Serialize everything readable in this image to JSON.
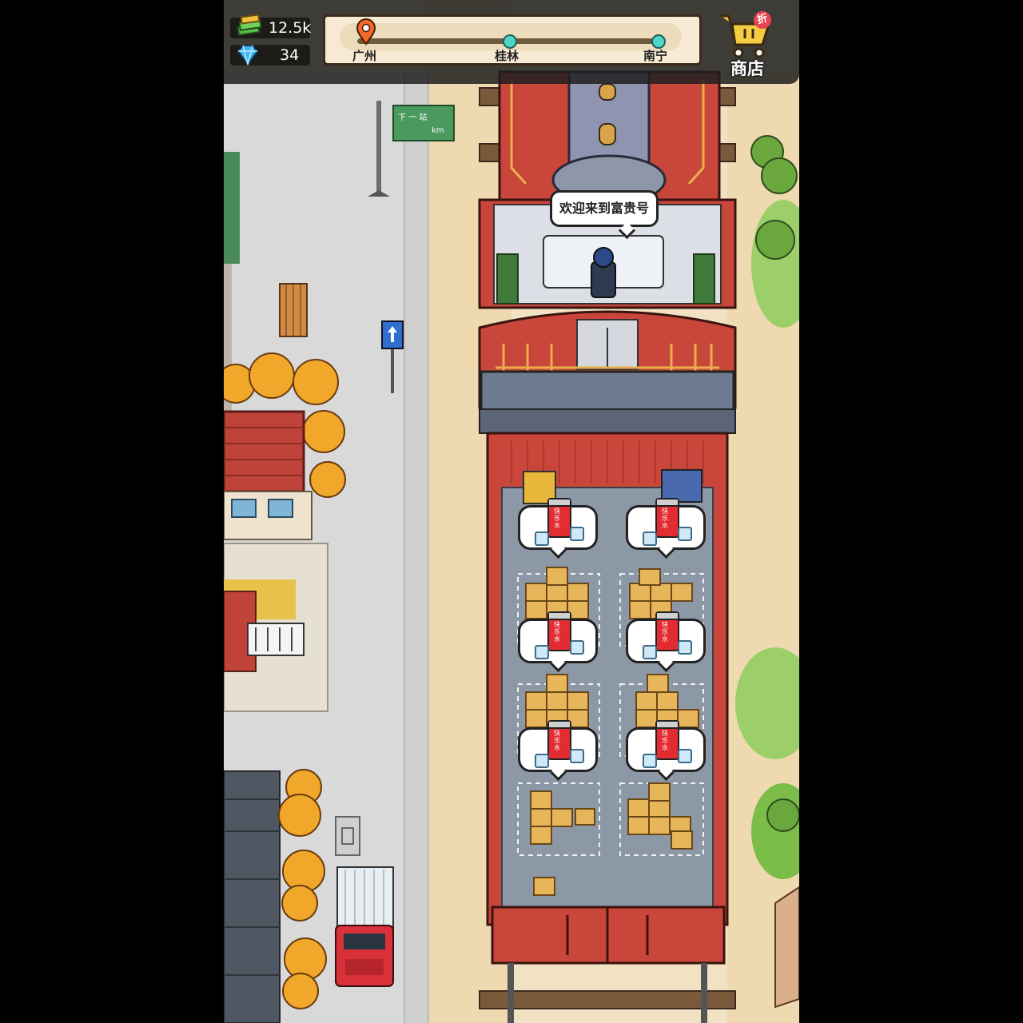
{
  "hud": {
    "money": "12.5k",
    "gems": "34",
    "money_icon": "cash-stack-icon",
    "gem_icon": "diamond-icon"
  },
  "route": {
    "stops": [
      "广州",
      "桂林",
      "南宁"
    ],
    "current_stop_index": 0,
    "marker_icon": "location-pin-icon"
  },
  "shop": {
    "label": "商店",
    "badge": "折",
    "icon": "shopping-cart-icon"
  },
  "train": {
    "welcome_message": "欢迎来到富贵号"
  },
  "cargo": {
    "item_label": "快乐水",
    "bubble_count": 6
  },
  "sign": {
    "line1": "下 一 站",
    "line2": "km"
  },
  "colors": {
    "train_red": "#c8463a",
    "deck_gray": "#8d98a6",
    "road_gray": "#dcdcdc",
    "accent_teal": "#4fd6c8"
  }
}
